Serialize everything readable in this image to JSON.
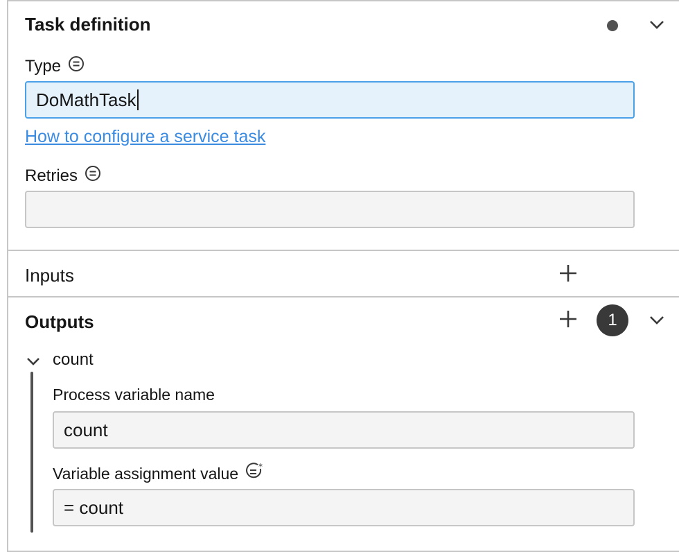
{
  "task_definition": {
    "title": "Task definition",
    "type_label": "Type",
    "type_value": "DoMathTask",
    "help_link": "How to configure a service task",
    "retries_label": "Retries",
    "retries_value": ""
  },
  "inputs": {
    "title": "Inputs"
  },
  "outputs": {
    "title": "Outputs",
    "count_badge": "1",
    "entry": {
      "name": "count",
      "process_variable_label": "Process variable name",
      "process_variable_value": "count",
      "assignment_label": "Variable assignment value",
      "assignment_value": "= count"
    }
  },
  "icons": {
    "type_field_icon": "list-equals-icon",
    "retries_field_icon": "list-equals-icon",
    "assignment_field_icon": "feel-expression-icon",
    "collapse": "chevron-down-icon",
    "add": "plus-icon",
    "status": "dot-indicator-icon"
  },
  "colors": {
    "focus_bg": "#e5f2fc",
    "focus_border": "#4ba1e8",
    "link": "#3b8be0",
    "badge": "#393939"
  }
}
